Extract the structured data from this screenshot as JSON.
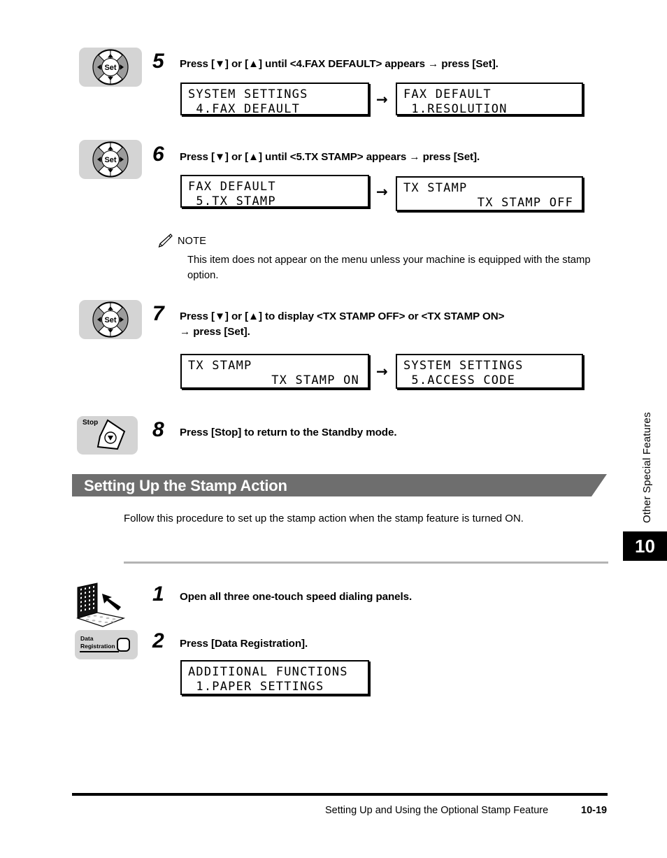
{
  "steps": [
    {
      "number": "5",
      "icon": "set-key-icon",
      "icon_label": "Set",
      "text": "Press [▼] or [▲] until <4.FAX DEFAULT> appears → press [Set].",
      "lcds": [
        {
          "line1": "SYSTEM SETTINGS",
          "line2": " 4.FAX DEFAULT",
          "align2": "left"
        },
        {
          "line1": "FAX DEFAULT",
          "line2": " 1.RESOLUTION",
          "align2": "left"
        }
      ],
      "arrow": "→"
    },
    {
      "number": "6",
      "icon": "set-key-icon",
      "icon_label": "Set",
      "text": "Press [▼] or [▲] until <5.TX STAMP> appears → press [Set].",
      "lcds": [
        {
          "line1": "FAX DEFAULT",
          "line2": " 5.TX STAMP",
          "align2": "left"
        },
        {
          "line1": "TX STAMP",
          "line2": "TX STAMP OFF",
          "align2": "right"
        }
      ],
      "arrow": "→"
    },
    {
      "number": "7",
      "icon": "set-key-icon",
      "icon_label": "Set",
      "text": "Press [▼] or [▲] to display <TX STAMP OFF> or <TX STAMP ON>\n→ press [Set].",
      "lcds": [
        {
          "line1": "TX STAMP",
          "line2": "TX STAMP ON",
          "align2": "right"
        },
        {
          "line1": "SYSTEM SETTINGS",
          "line2": " 5.ACCESS CODE",
          "align2": "left"
        }
      ],
      "arrow": "→"
    },
    {
      "number": "8",
      "icon": "stop-key-icon",
      "icon_label": "Stop",
      "text": "Press [Stop] to return to the Standby mode.",
      "lcds": [],
      "arrow": ""
    }
  ],
  "note": {
    "icon": "pencil-icon",
    "heading": "NOTE",
    "body": "This item does not appear on the menu unless your machine is equipped with the stamp option."
  },
  "section": {
    "title": "Setting Up the Stamp Action",
    "intro": "Follow this procedure to set up the stamp action when the stamp feature is turned ON."
  },
  "section_steps": [
    {
      "number": "1",
      "icon": "speed-dial-panels-icon",
      "icon_label": "",
      "text": "Open all three one-touch speed dialing panels.",
      "lcds": []
    },
    {
      "number": "2",
      "icon": "data-registration-key-icon",
      "icon_label_line1": "Data",
      "icon_label_line2": "Registration",
      "text": "Press [Data Registration].",
      "lcds": [
        {
          "line1": "ADDITIONAL FUNCTIONS",
          "line2": " 1.PAPER SETTINGS",
          "align2": "left"
        }
      ]
    }
  ],
  "side": {
    "vertical_text": "Other Special Features",
    "tab_number": "10"
  },
  "footer": {
    "title": "Setting Up and Using the Optional Stamp Feature",
    "page": "10-19"
  },
  "colors": {
    "key_grey": "#d4d4d4",
    "banner_grey": "#6e6e6e",
    "rule_grey": "#b3b3b3",
    "tab_black": "#000000"
  }
}
